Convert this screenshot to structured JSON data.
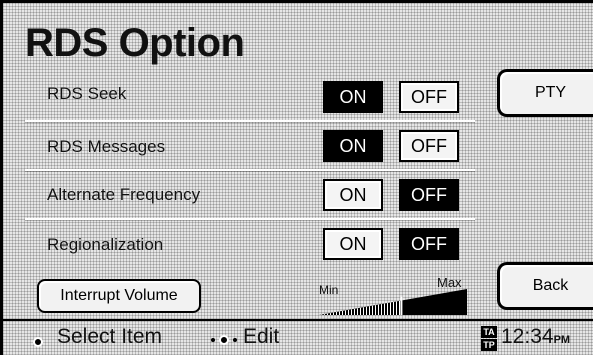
{
  "screen": {
    "title": "RDS Option"
  },
  "options": [
    {
      "label": "RDS Seek",
      "on_label": "ON",
      "off_label": "OFF",
      "state": "ON"
    },
    {
      "label": "RDS Messages",
      "on_label": "ON",
      "off_label": "OFF",
      "state": "ON"
    },
    {
      "label": "Alternate Frequency",
      "on_label": "ON",
      "off_label": "OFF",
      "state": "OFF"
    },
    {
      "label": "Regionalization",
      "on_label": "ON",
      "off_label": "OFF",
      "state": "OFF"
    }
  ],
  "side_buttons": {
    "pty": "PTY",
    "back": "Back"
  },
  "interrupt_volume": {
    "button_label": "Interrupt Volume",
    "min_label": "Min",
    "max_label": "Max",
    "level": 0.55
  },
  "status_bar": {
    "select_hint": "Select Item",
    "edit_hint": "Edit",
    "ta_badge": "TA",
    "tp_badge": "TP",
    "time": "12:34",
    "ampm": "PM"
  },
  "colors": {
    "selected_bg": "#000000",
    "unselected_bg": "#f4f4f4",
    "screen_bg": "#e6e6e6"
  }
}
